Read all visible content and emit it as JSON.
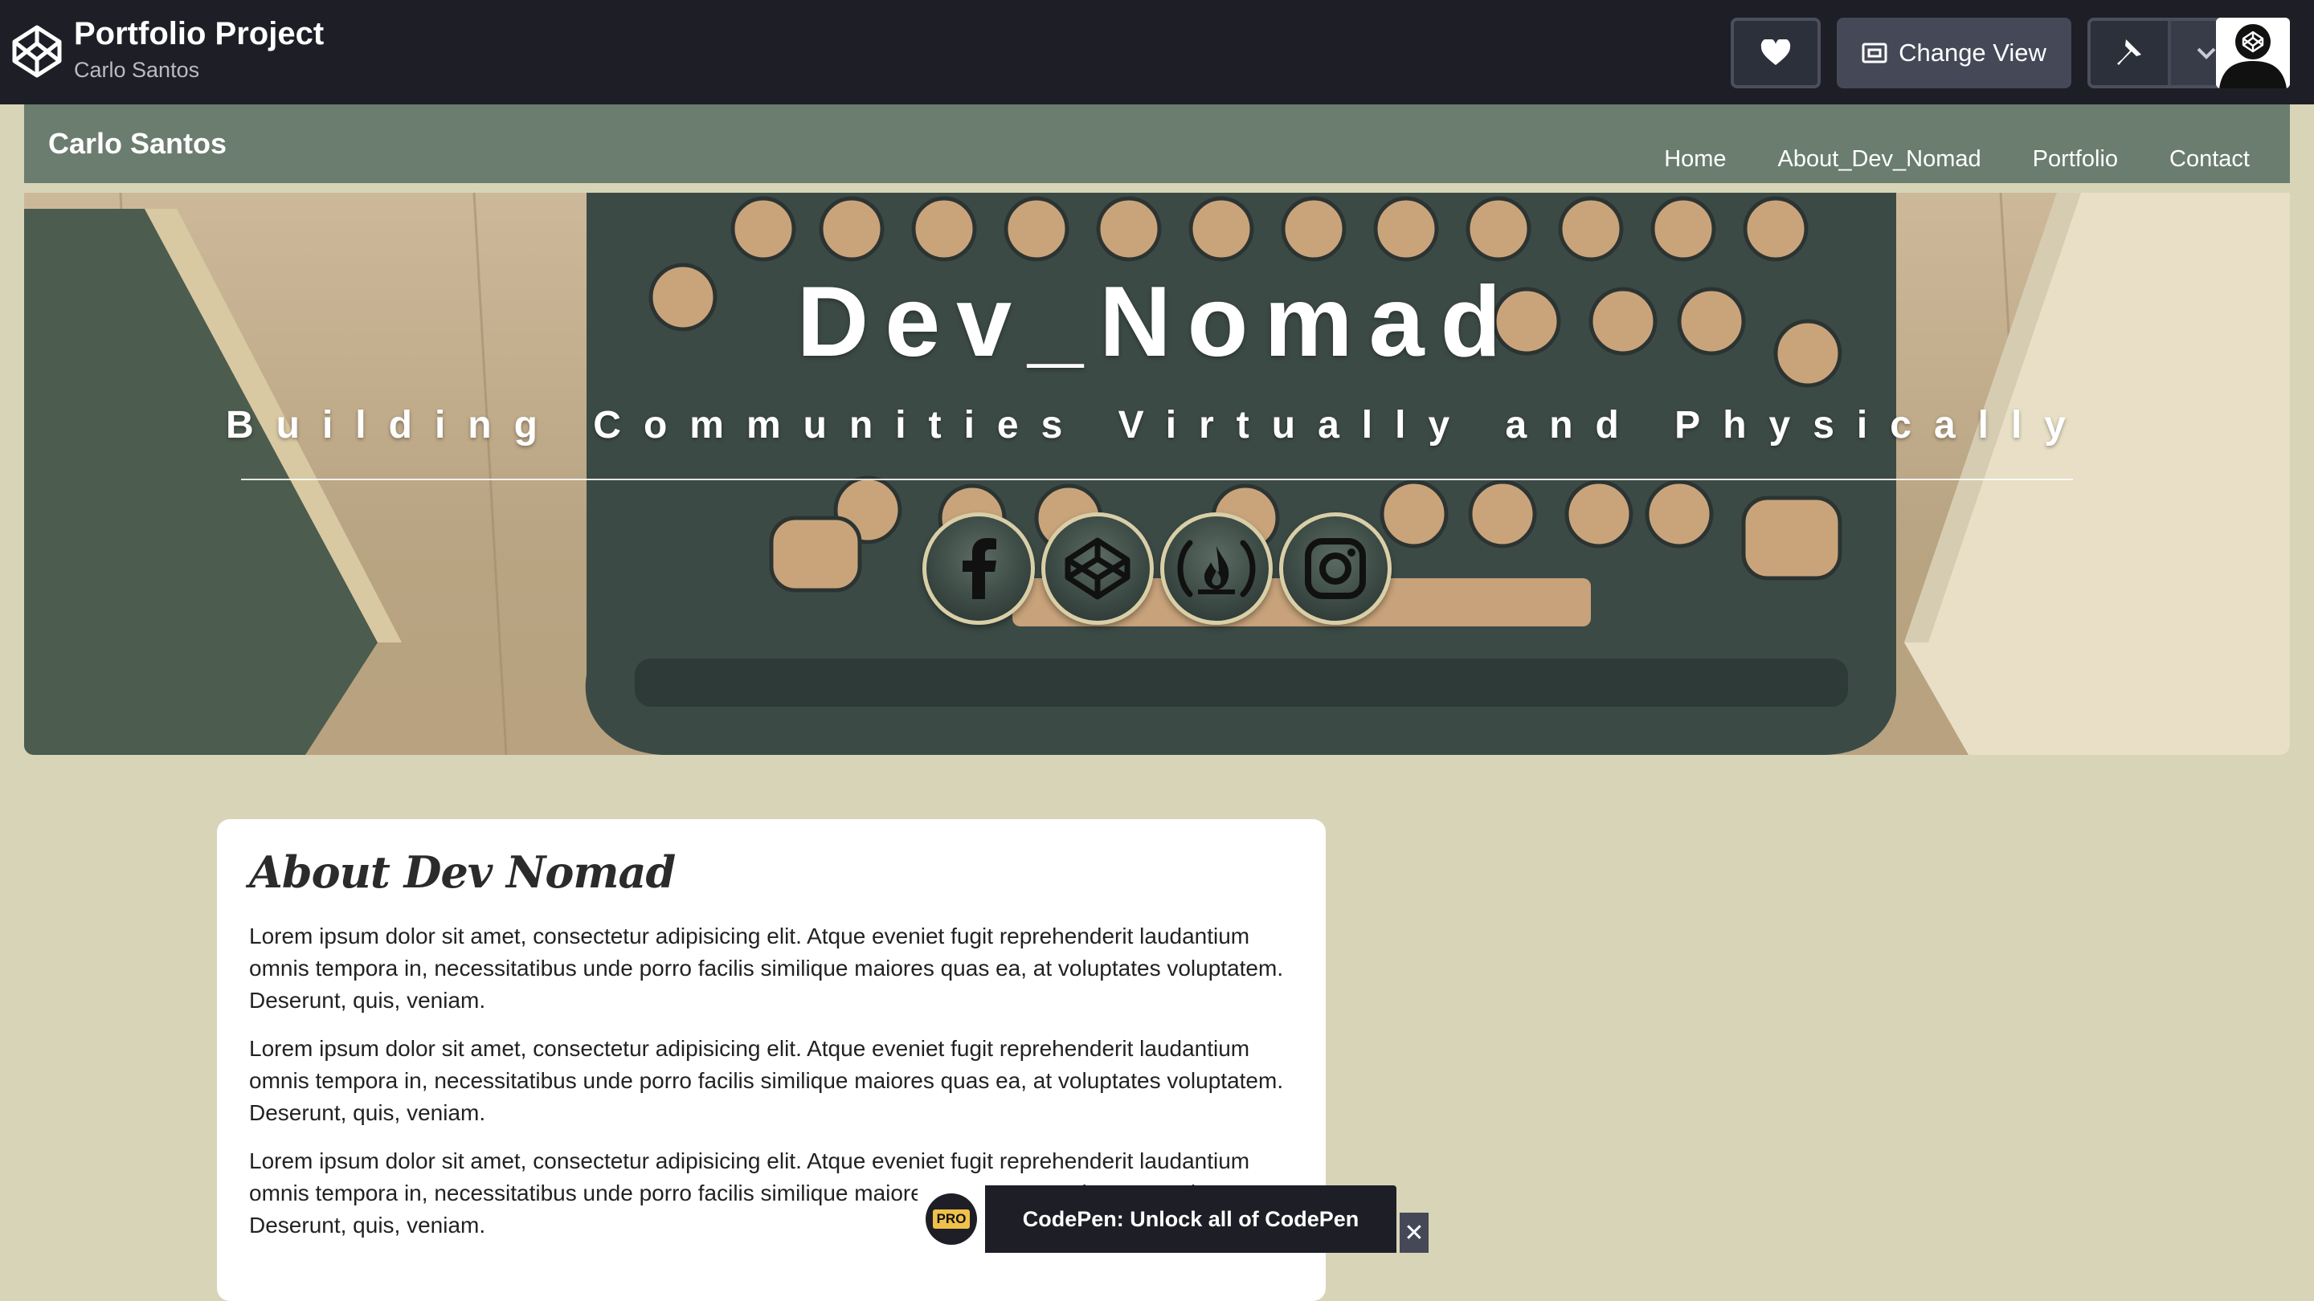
{
  "codepen": {
    "title": "Portfolio Project",
    "author": "Carlo Santos",
    "change_view_label": "Change View",
    "icons": [
      "codepen-logo-icon",
      "heart-icon",
      "layout-icon",
      "pin-icon",
      "chevron-down-icon",
      "avatar"
    ]
  },
  "site": {
    "brand": "Carlo Santos",
    "nav": [
      {
        "label": "Home"
      },
      {
        "label": "About_Dev_Nomad"
      },
      {
        "label": "Portfolio"
      },
      {
        "label": "Contact"
      }
    ]
  },
  "hero": {
    "title": "Dev_Nomad",
    "subtitle": "Building Communities Virtually and Physically",
    "socials": [
      "facebook-icon",
      "codepen-icon",
      "freecodecamp-icon",
      "instagram-icon"
    ]
  },
  "about": {
    "heading": "About Dev Nomad",
    "paragraphs": [
      "Lorem ipsum dolor sit amet, consectetur adipisicing elit. Atque eveniet fugit reprehenderit laudantium omnis tempora in, necessitatibus unde porro facilis similique maiores quas ea, at voluptates voluptatem. Deserunt, quis, veniam.",
      "Lorem ipsum dolor sit amet, consectetur adipisicing elit. Atque eveniet fugit reprehenderit laudantium omnis tempora in, necessitatibus unde porro facilis similique maiores quas ea, at voluptates voluptatem. Deserunt, quis, veniam.",
      "Lorem ipsum dolor sit amet, consectetur adipisicing elit. Atque eveniet fugit reprehenderit laudantium omnis tempora in, necessitatibus unde porro facilis similique maiores quas ea, at voluptates voluptatem. Deserunt, quis, veniam."
    ]
  },
  "toast": {
    "badge": "PRO",
    "text": "CodePen: Unlock all of CodePen",
    "close": "✕"
  },
  "colors": {
    "codepen_bar": "#1e1f26",
    "nav_bg": "#6b7d6e",
    "page_bg": "#d8d4b7",
    "pro_yellow": "#f0c14a"
  }
}
